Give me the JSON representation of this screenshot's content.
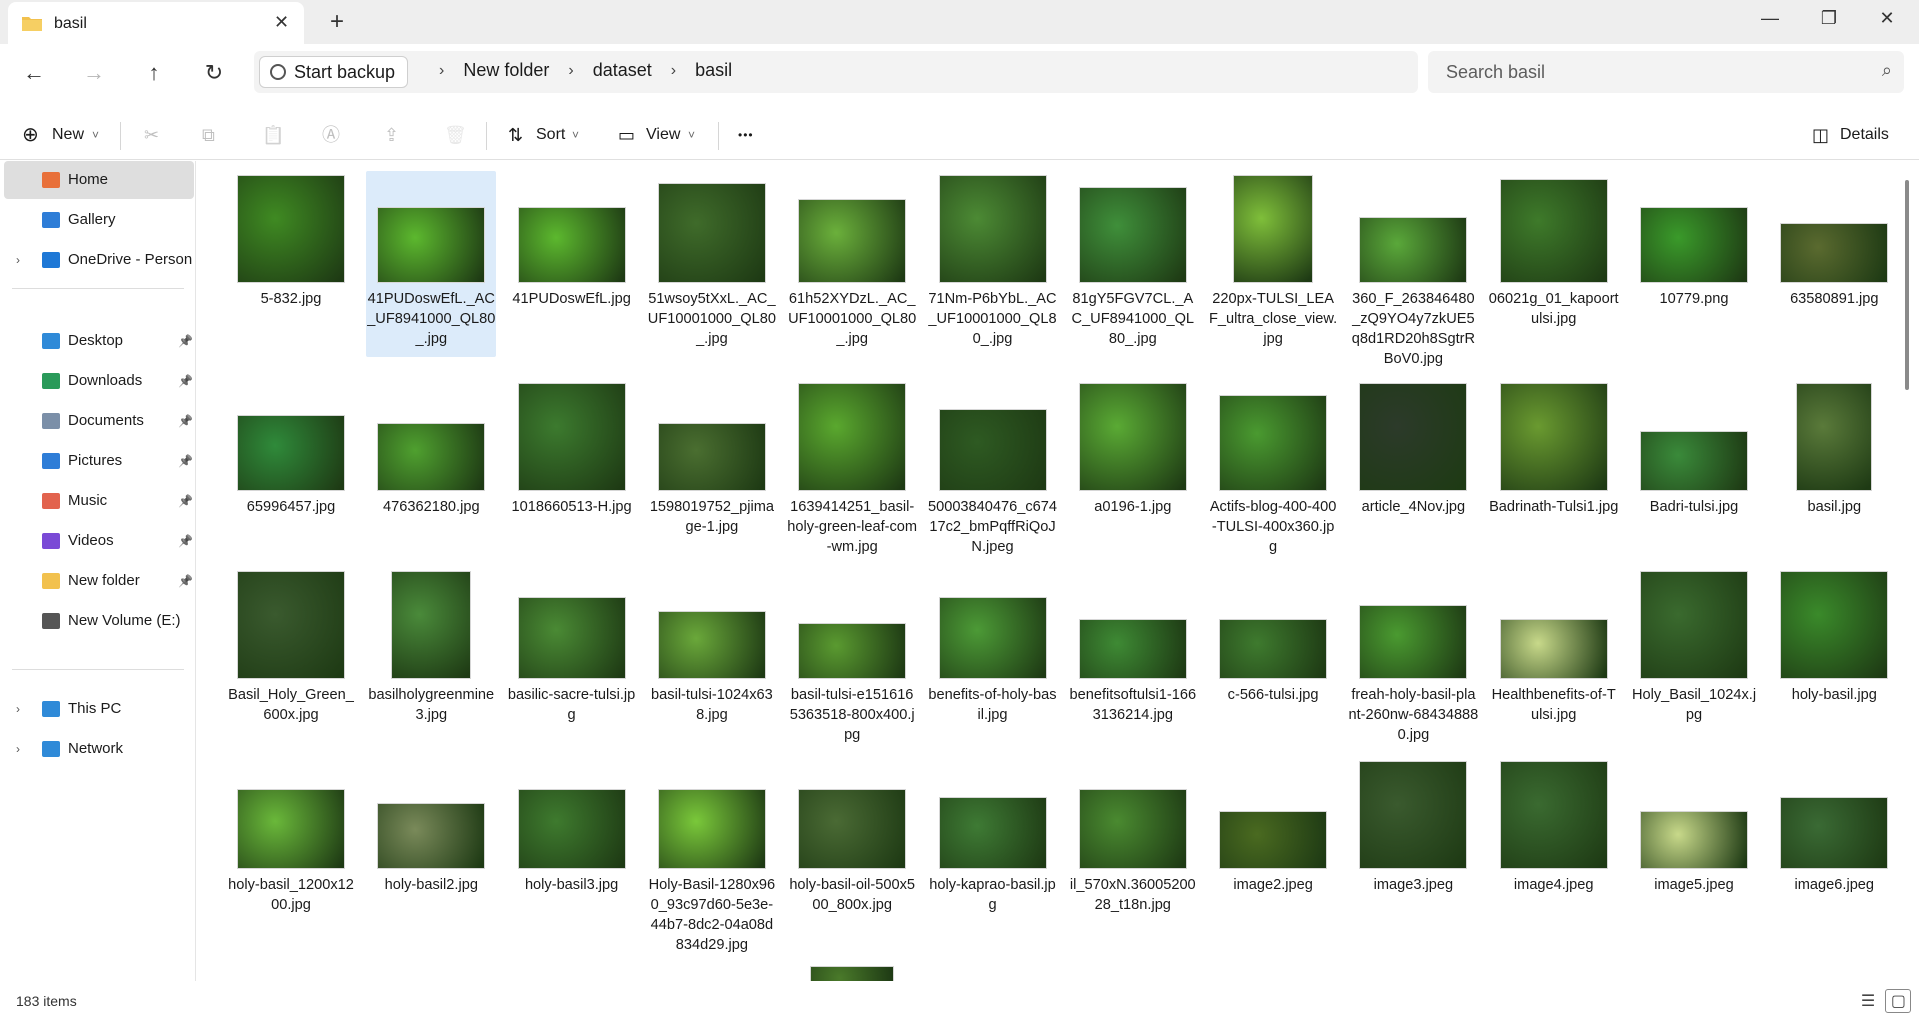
{
  "window": {
    "tab_title": "basil",
    "tab_close": "✕",
    "new_tab": "+",
    "minimize": "—",
    "maximize": "❐",
    "close": "✕"
  },
  "nav": {
    "back": "←",
    "forward": "→",
    "up": "↑",
    "refresh": "↻",
    "start_backup": "Start backup",
    "crumbs": [
      "New folder",
      "dataset",
      "basil"
    ],
    "crumb_sep": "›",
    "search_placeholder": "Search basil",
    "search_icon": "⌕"
  },
  "toolbar": {
    "new": "New",
    "sort": "Sort",
    "view": "View",
    "more": "•••",
    "details": "Details",
    "new_icon": "⊕",
    "sort_icon": "⇅",
    "view_icon": "▭",
    "cut_icon": "✂",
    "copy_icon": "⧉",
    "paste_icon": "📋",
    "rename_icon": "Ⓐ",
    "share_icon": "⇪",
    "delete_icon": "🗑",
    "details_icon": "◫",
    "caret": "˅"
  },
  "sidebar": {
    "items": [
      {
        "label": "Home",
        "icon": "home-icon",
        "color": "#e8703a"
      },
      {
        "label": "Gallery",
        "icon": "gallery-icon",
        "color": "#2e7dd7"
      },
      {
        "label": "OneDrive - Persona",
        "icon": "onedrive-icon",
        "color": "#1e78d6"
      },
      {
        "label": "Desktop",
        "icon": "desktop-icon",
        "color": "#2f8ad8"
      },
      {
        "label": "Downloads",
        "icon": "download-icon",
        "color": "#2a9a5a"
      },
      {
        "label": "Documents",
        "icon": "documents-icon",
        "color": "#7b8fa8"
      },
      {
        "label": "Pictures",
        "icon": "pictures-icon",
        "color": "#2e7dd7"
      },
      {
        "label": "Music",
        "icon": "music-icon",
        "color": "#e2634e"
      },
      {
        "label": "Videos",
        "icon": "videos-icon",
        "color": "#7a4ad6"
      },
      {
        "label": "New folder",
        "icon": "folder-icon",
        "color": "#f2c14e"
      },
      {
        "label": "New Volume (E:)",
        "icon": "drive-icon",
        "color": "#555555"
      },
      {
        "label": "This PC",
        "icon": "pc-icon",
        "color": "#2f8ad8"
      },
      {
        "label": "Network",
        "icon": "network-icon",
        "color": "#2f8ad8"
      }
    ],
    "pin": "📌",
    "chevron": "›"
  },
  "files": [
    {
      "name": "5-832.jpg",
      "tone": "#3f8a22"
    },
    {
      "name": "41PUDoswEfL._AC_UF8941000_QL80_.jpg",
      "tone": "#5cb82e"
    },
    {
      "name": "41PUDoswEfL.jpg",
      "tone": "#5cb82e"
    },
    {
      "name": "51wsoy5tXxL._AC_UF10001000_QL80_.jpg",
      "tone": "#3f6b2a"
    },
    {
      "name": "61h52XYDzL._AC_UF10001000_QL80_.jpg",
      "tone": "#6bb03b"
    },
    {
      "name": "71Nm-P6bYbL._AC_UF10001000_QL80_.jpg",
      "tone": "#4c8a34"
    },
    {
      "name": "81gY5FGV7CL._AC_UF8941000_QL80_.jpg",
      "tone": "#3f8f3a"
    },
    {
      "name": "220px-TULSI_LEAF_ultra_close_view.jpg",
      "tone": "#7fbf3a"
    },
    {
      "name": "360_F_263846480_zQ9YO4y7zkUE5q8d1RD20h8SgtrRBoV0.jpg",
      "tone": "#5aa83a"
    },
    {
      "name": "06021g_01_kapoortulsi.jpg",
      "tone": "#3e7a2a"
    },
    {
      "name": "10779.png",
      "tone": "#3a9a2a"
    },
    {
      "name": "63580891.jpg",
      "tone": "#5a6a2f"
    },
    {
      "name": "65996457.jpg",
      "tone": "#2f8a3a"
    },
    {
      "name": "476362180.jpg",
      "tone": "#4fa02f"
    },
    {
      "name": "1018660513-H.jpg",
      "tone": "#3c7a2e"
    },
    {
      "name": "1598019752_pjimage-1.jpg",
      "tone": "#4a6e30"
    },
    {
      "name": "1639414251_basil-holy-green-leaf-com-wm.jpg",
      "tone": "#5aa82e"
    },
    {
      "name": "50003840476_c67417c2_bmPqffRiQoJN.jpeg",
      "tone": "#2e5a22"
    },
    {
      "name": "a0196-1.jpg",
      "tone": "#5aaa34"
    },
    {
      "name": "Actifs-blog-400-400-TULSI-400x360.jpg",
      "tone": "#4a9a30"
    },
    {
      "name": "article_4Nov.jpg",
      "tone": "#2c3a2a"
    },
    {
      "name": "Badrinath-Tulsi1.jpg",
      "tone": "#6a9a30"
    },
    {
      "name": "Badri-tulsi.jpg",
      "tone": "#3a8a3a"
    },
    {
      "name": "basil.jpg",
      "tone": "#5a7a3a"
    },
    {
      "name": "Basil_Holy_Green_600x.jpg",
      "tone": "#3a5a2e"
    },
    {
      "name": "basilholygreenmine3.jpg",
      "tone": "#4a8a3a"
    },
    {
      "name": "basilic-sacre-tulsi.jpg",
      "tone": "#4a8a34"
    },
    {
      "name": "basil-tulsi-1024x638.jpg",
      "tone": "#6aa83a"
    },
    {
      "name": "basil-tulsi-e1516165363518-800x400.jpg",
      "tone": "#5a9a30"
    },
    {
      "name": "benefits-of-holy-basil.jpg",
      "tone": "#4c9a36"
    },
    {
      "name": "benefitsoftulsi1-1663136214.jpg",
      "tone": "#3e8a34"
    },
    {
      "name": "c-566-tulsi.jpg",
      "tone": "#3e7a2e"
    },
    {
      "name": "freah-holy-basil-plant-260nw-684348880.jpg",
      "tone": "#4a9a30"
    },
    {
      "name": "Healthbenefits-of-Tulsi.jpg",
      "tone": "#c8d98a"
    },
    {
      "name": "Holy_Basil_1024x.jpg",
      "tone": "#3a6a2e"
    },
    {
      "name": "holy-basil.jpg",
      "tone": "#3a8a2a"
    },
    {
      "name": "holy-basil_1200x1200.jpg",
      "tone": "#6ab83a"
    },
    {
      "name": "holy-basil2.jpg",
      "tone": "#7a8a5a"
    },
    {
      "name": "holy-basil3.jpg",
      "tone": "#3e7a2e"
    },
    {
      "name": "Holy-Basil-1280x960_93c97d60-5e3e-44b7-8dc2-04a08d834d29.jpg",
      "tone": "#7ac83a"
    },
    {
      "name": "holy-basil-oil-500x500_800x.jpg",
      "tone": "#4a6a34"
    },
    {
      "name": "holy-kaprao-basil.jpg",
      "tone": "#3e7a34"
    },
    {
      "name": "il_570xN.3600520028_t18n.jpg",
      "tone": "#4a8a30"
    },
    {
      "name": "image2.jpeg",
      "tone": "#4a6a20"
    },
    {
      "name": "image3.jpeg",
      "tone": "#3a5a2e"
    },
    {
      "name": "image4.jpeg",
      "tone": "#3a6a30"
    },
    {
      "name": "image5.jpeg",
      "tone": "#c8d98a"
    },
    {
      "name": "image6.jpeg",
      "tone": "#3a6a34"
    },
    {
      "name": "",
      "tone": "#4a7a2a"
    }
  ],
  "status": {
    "count": "183 items",
    "details_view_icon": "☰",
    "tiles_view_icon": "▢"
  }
}
